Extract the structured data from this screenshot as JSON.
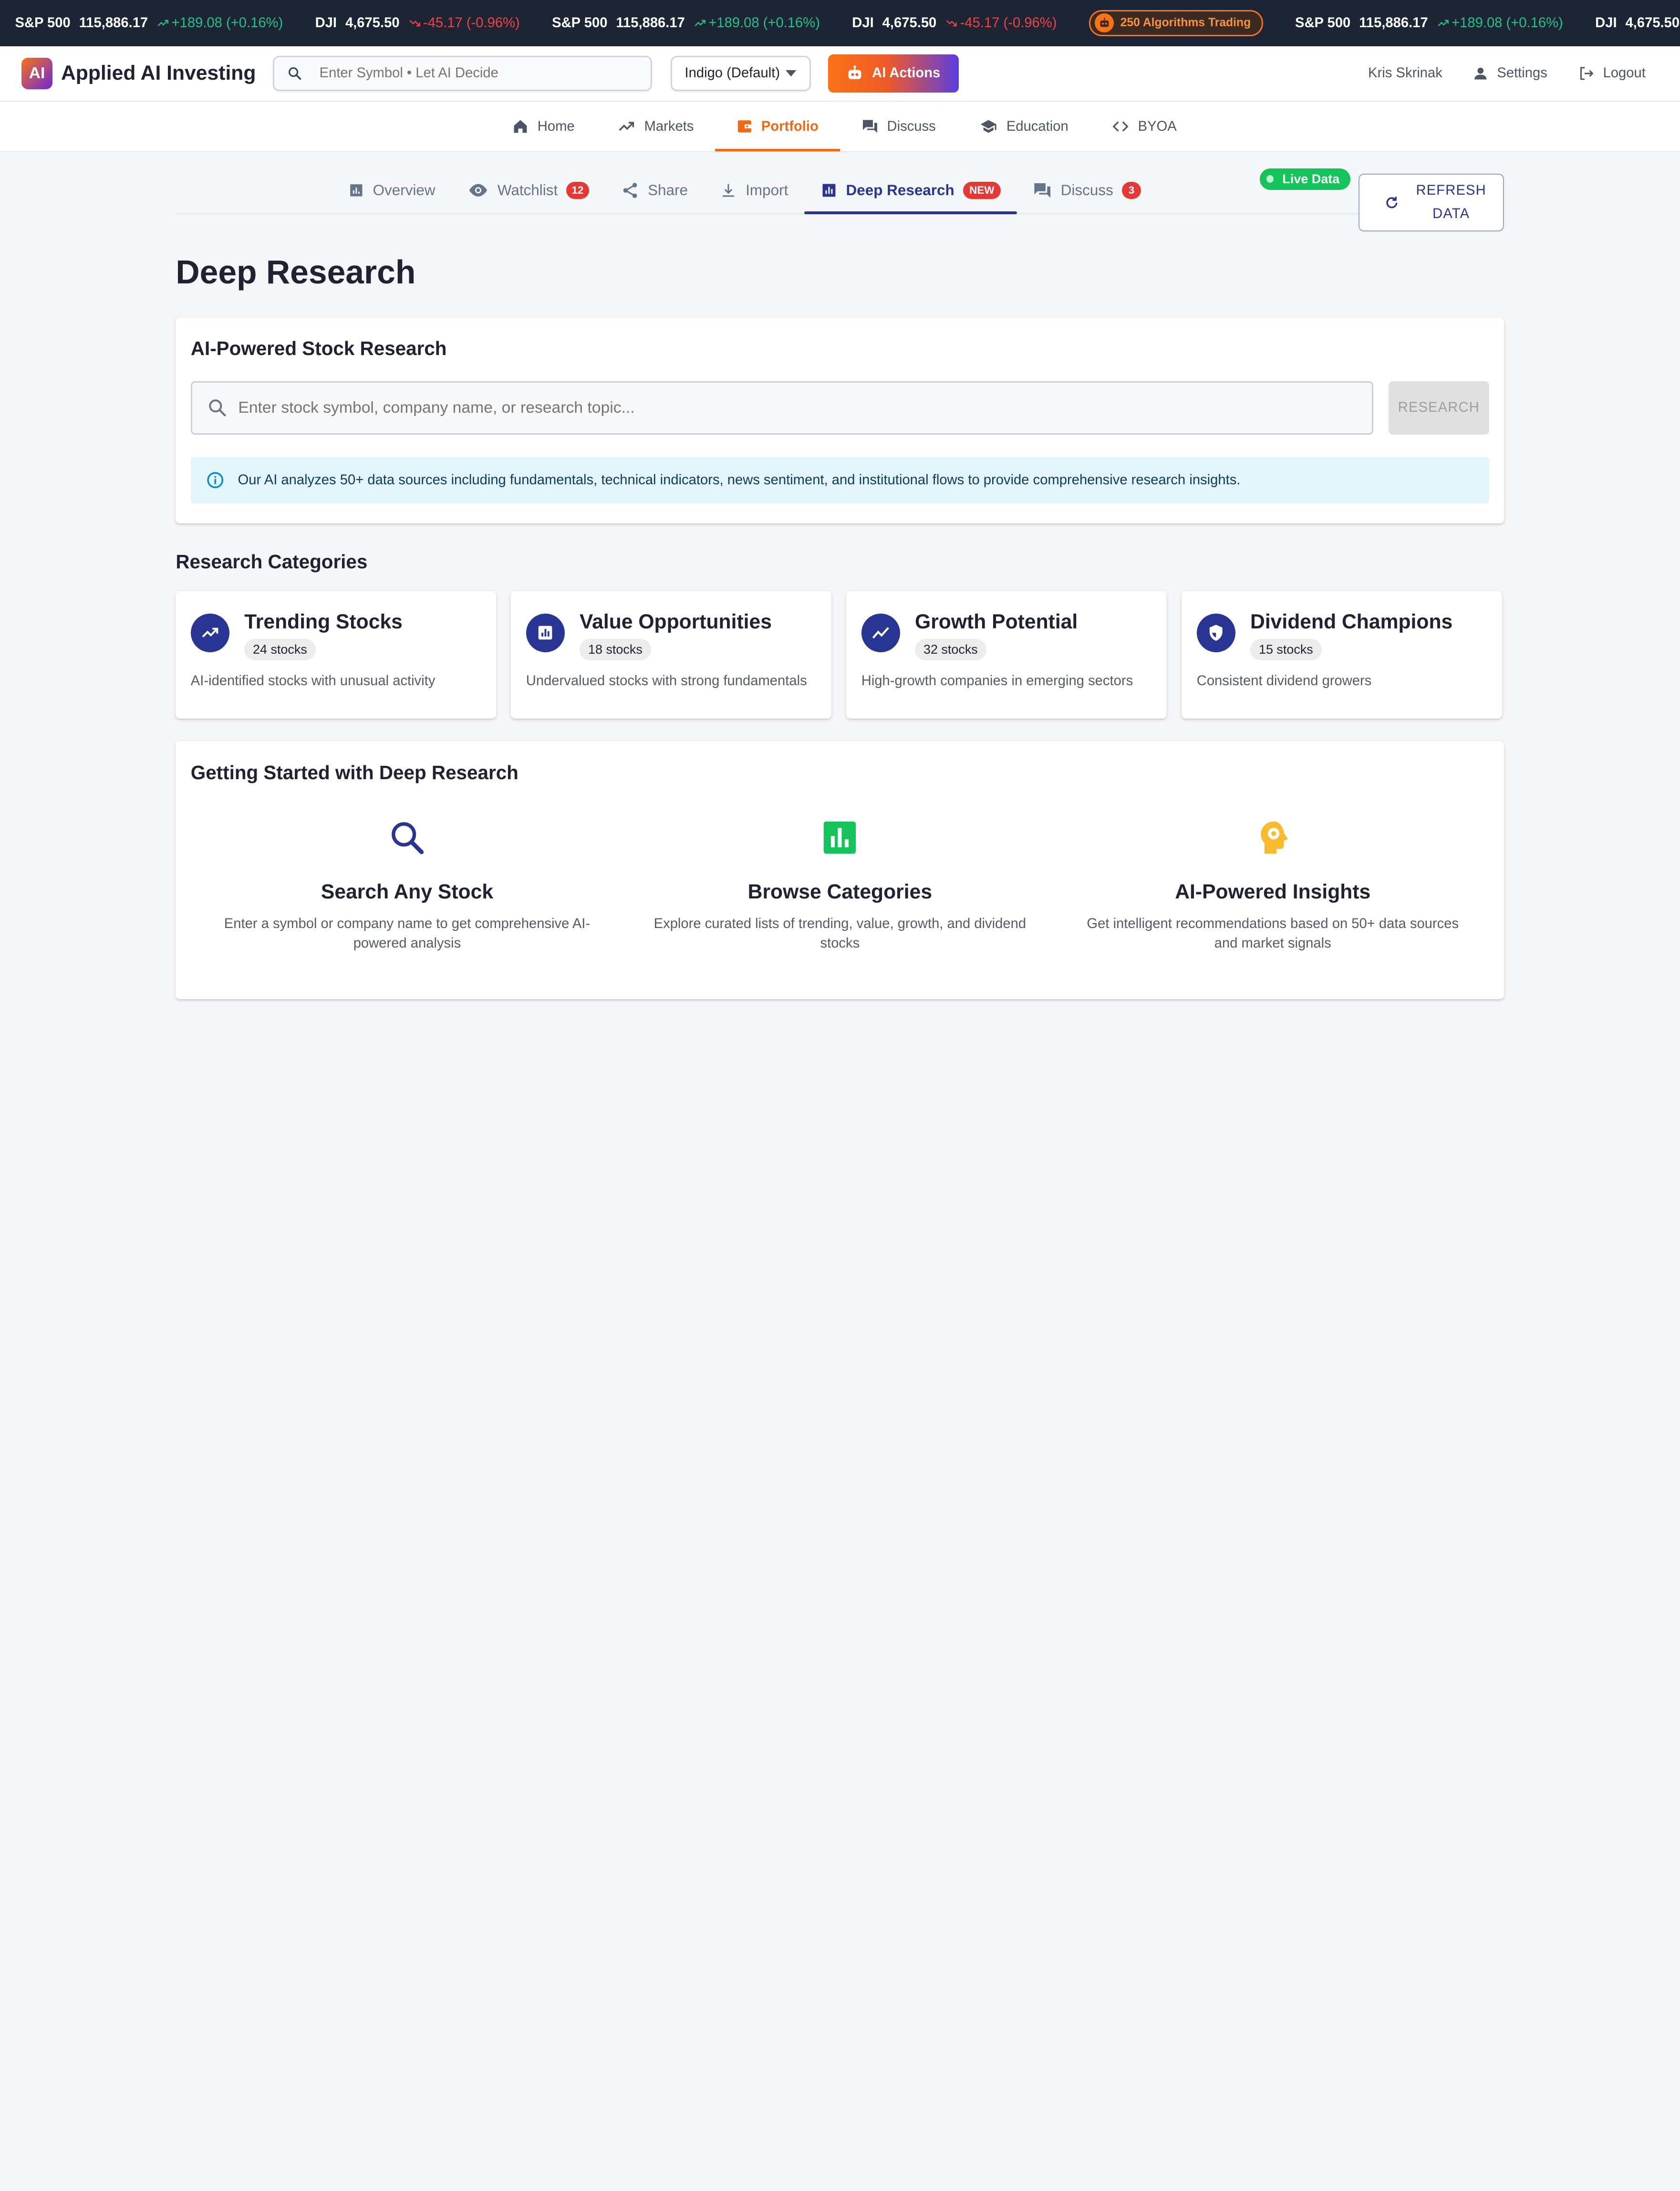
{
  "ticker": {
    "items": [
      {
        "symbol": "S&P 500",
        "value": "115,886.17",
        "change": "+189.08 (+0.16%)",
        "dir": "up"
      },
      {
        "symbol": "DJI",
        "value": "4,675.50",
        "change": "-45.17 (-0.96%)",
        "dir": "down"
      },
      {
        "symbol": "S&P 500",
        "value": "115,886.17",
        "change": "+189.08 (+0.16%)",
        "dir": "up"
      },
      {
        "symbol": "DJI",
        "value": "4,675.50",
        "change": "-45.17 (-0.96%)",
        "dir": "down"
      }
    ],
    "algo_badge": "250 Algorithms Trading",
    "tail": [
      {
        "symbol": "S&P 500",
        "value": "115,886.17",
        "change": "+189.08 (+0.16%)",
        "dir": "up"
      },
      {
        "symbol": "DJI",
        "value": "4,675.50",
        "change": "",
        "dir": "down"
      }
    ],
    "colors": {
      "up": "#22c08a",
      "down": "#ef4444"
    }
  },
  "topbar": {
    "logo_badge": "AI",
    "app_name": "Applied AI Investing",
    "search_placeholder": "Enter Symbol • Let AI Decide",
    "theme_value": "Indigo (Default)",
    "ai_actions_label": "AI Actions",
    "user_name": "Kris Skrinak",
    "settings_label": "Settings",
    "logout_label": "Logout"
  },
  "mainnav": {
    "items": [
      {
        "label": "Home",
        "icon": "home-icon"
      },
      {
        "label": "Markets",
        "icon": "trending-up-icon"
      },
      {
        "label": "Portfolio",
        "icon": "wallet-icon",
        "active": true
      },
      {
        "label": "Discuss",
        "icon": "forum-icon"
      },
      {
        "label": "Education",
        "icon": "school-icon"
      },
      {
        "label": "BYOA",
        "icon": "code-icon"
      }
    ]
  },
  "subtabs": {
    "overview": "Overview",
    "watchlist": "Watchlist",
    "watchlist_count": "12",
    "share": "Share",
    "import": "Import",
    "deep_research": "Deep Research",
    "deep_research_badge": "NEW",
    "discuss": "Discuss",
    "discuss_count": "3"
  },
  "live_data_label": "Live Data",
  "refresh_label_line1": "REFRESH",
  "refresh_label_line2": "DATA",
  "page_title": "Deep Research",
  "research": {
    "title": "AI-Powered Stock Research",
    "input_placeholder": "Enter stock symbol, company name, or research topic...",
    "button_label": "RESEARCH",
    "info_text": "Our AI analyzes 50+ data sources including fundamentals, technical indicators, news sentiment, and institutional flows to provide comprehensive research insights."
  },
  "categories": {
    "title": "Research Categories",
    "items": [
      {
        "title": "Trending Stocks",
        "count": "24 stocks",
        "desc": "AI-identified stocks with unusual activity",
        "icon": "trending-up-icon"
      },
      {
        "title": "Value Opportunities",
        "count": "18 stocks",
        "desc": "Undervalued stocks with strong fundamentals",
        "icon": "bar-chart-icon"
      },
      {
        "title": "Growth Potential",
        "count": "32 stocks",
        "desc": "High-growth companies in emerging sectors",
        "icon": "show-chart-icon"
      },
      {
        "title": "Dividend Champions",
        "count": "15 stocks",
        "desc": "Consistent dividend growers",
        "icon": "shield-icon"
      }
    ],
    "icon_color": "#283593"
  },
  "getting_started": {
    "title": "Getting Started with Deep Research",
    "items": [
      {
        "title": "Search Any Stock",
        "desc": "Enter a symbol or company name to get comprehensive AI-powered analysis",
        "icon": "search-icon",
        "color": "#283593"
      },
      {
        "title": "Browse Categories",
        "desc": "Explore curated lists of trending, value, growth, and dividend stocks",
        "icon": "bar-chart-icon",
        "color": "#14c35a"
      },
      {
        "title": "AI-Powered Insights",
        "desc": "Get intelligent recommendations based on 50+ data sources and market signals",
        "icon": "psychology-icon",
        "color": "#fbb92e"
      }
    ]
  }
}
